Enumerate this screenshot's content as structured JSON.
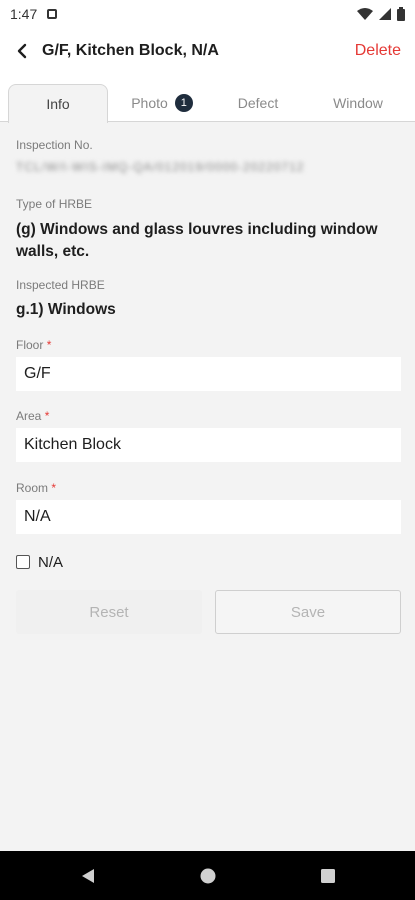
{
  "status_bar": {
    "time": "1:47",
    "icons": [
      "notification-icon",
      "wifi-icon",
      "signal-icon",
      "battery-icon"
    ]
  },
  "header": {
    "title": "G/F, Kitchen Block, N/A",
    "delete_label": "Delete",
    "delete_color": "#e53935"
  },
  "tabs": [
    {
      "label": "Info",
      "active": true
    },
    {
      "label": "Photo",
      "badge": "1"
    },
    {
      "label": "Defect"
    },
    {
      "label": "Window"
    }
  ],
  "form": {
    "inspection_no_label": "Inspection No.",
    "inspection_no_value": "TCL/W/I-WIS-IMQ-QA/012019/0000-20220712",
    "type_label": "Type of HRBE",
    "type_value": "(g) Windows and glass louvres including window walls, etc.",
    "inspected_label": "Inspected HRBE",
    "inspected_value": "g.1) Windows",
    "floor_label": "Floor",
    "floor_value": "G/F",
    "area_label": "Area",
    "area_value": "Kitchen Block",
    "room_label": "Room",
    "room_value": "N/A",
    "required_mark": "*",
    "na_checkbox_label": "N/A",
    "na_checked": false,
    "reset_label": "Reset",
    "save_label": "Save"
  },
  "nav": {
    "icons": [
      "back-icon",
      "home-icon",
      "recents-icon"
    ]
  }
}
